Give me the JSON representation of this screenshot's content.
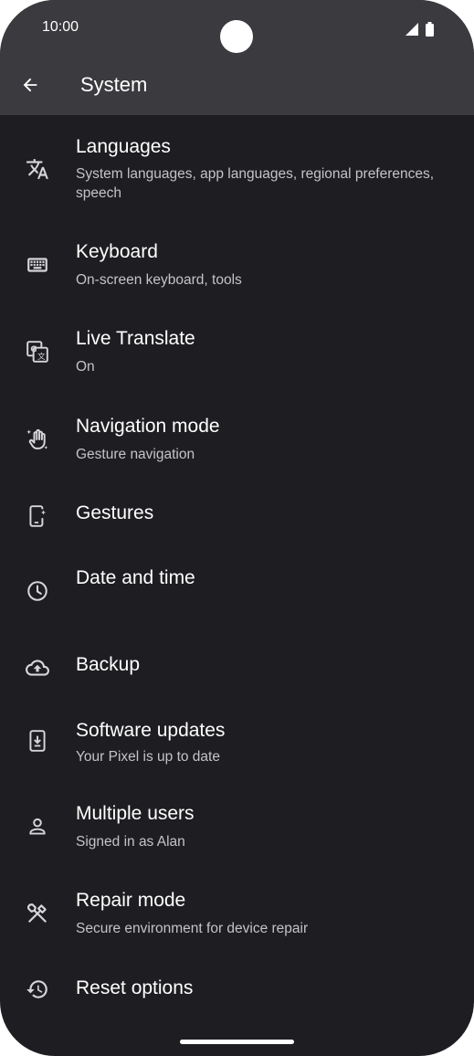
{
  "status_bar": {
    "time": "10:00"
  },
  "app_bar": {
    "title": "System"
  },
  "items": [
    {
      "title": "Languages",
      "subtitle": "System languages, app languages, regional preferences, speech",
      "icon": "translate-icon"
    },
    {
      "title": "Keyboard",
      "subtitle": "On-screen keyboard, tools",
      "icon": "keyboard-icon"
    },
    {
      "title": "Live Translate",
      "subtitle": "On",
      "icon": "live-translate-icon"
    },
    {
      "title": "Navigation mode",
      "subtitle": "Gesture navigation",
      "icon": "gesture-hand-icon"
    },
    {
      "title": "Gestures",
      "subtitle": "",
      "icon": "phone-gesture-icon"
    },
    {
      "title": "Date and time",
      "subtitle": "",
      "icon": "clock-icon"
    },
    {
      "title": "Backup",
      "subtitle": "",
      "icon": "cloud-upload-icon"
    },
    {
      "title": "Software updates",
      "subtitle": "Your Pixel is up to date",
      "icon": "system-update-icon"
    },
    {
      "title": "Multiple users",
      "subtitle": "Signed in as Alan",
      "icon": "person-icon"
    },
    {
      "title": "Repair mode",
      "subtitle": "Secure environment for device repair",
      "icon": "repair-tools-icon"
    },
    {
      "title": "Reset options",
      "subtitle": "",
      "icon": "history-reset-icon"
    }
  ]
}
